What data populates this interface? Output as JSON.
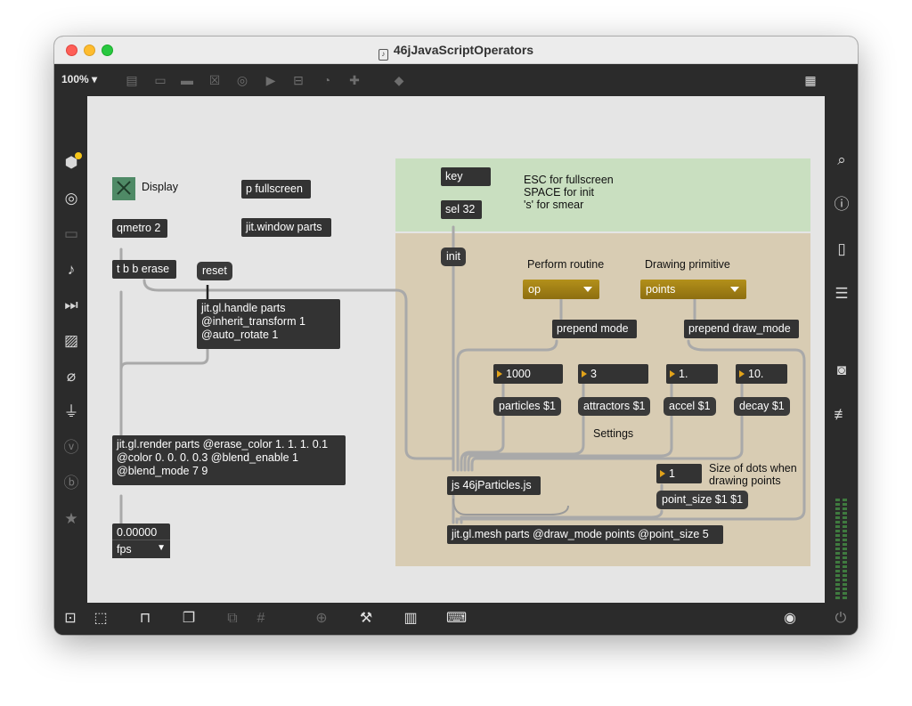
{
  "window": {
    "title": "46jJavaScriptOperators"
  },
  "toolbar": {
    "zoom": "100%"
  },
  "objects": {
    "qmetro": "qmetro 2",
    "tbb": "t b b erase",
    "reset": "reset",
    "handle": [
      "jit.gl.handle parts",
      "@inherit_transform 1",
      "@auto_rotate 1"
    ],
    "render": [
      "jit.gl.render parts @erase_color 1. 1. 1. 0.1",
      "@color 0. 0. 0. 0.3 @blend_enable 1",
      "@blend_mode 7 9"
    ],
    "fps_value": "0.00000",
    "fps_menu": "fps",
    "p_fullscreen": "p fullscreen",
    "jit_window": "jit.window parts",
    "key": "key",
    "sel": "sel 32",
    "init": "init",
    "mode_menu": "op",
    "draw_menu": "points",
    "prepend_mode": "prepend mode",
    "prepend_draw": "prepend draw_mode",
    "num_particles": "1000",
    "num_attractors": "3",
    "num_accel": "1.",
    "num_decay": "10.",
    "msg_particles": "particles $1",
    "msg_attractors": "attractors $1",
    "msg_accel": "accel $1",
    "msg_decay": "decay $1",
    "js": "js 46jParticles.js",
    "num_pointsize": "1",
    "msg_pointsize": "point_size $1 $1",
    "mesh": "jit.gl.mesh parts @draw_mode points @point_size 5"
  },
  "comments": {
    "display": "Display",
    "esc": [
      "ESC for fullscreen",
      "SPACE for init",
      "'s' for smear"
    ],
    "perform": "Perform routine",
    "drawing": "Drawing primitive",
    "settings": "Settings",
    "size": [
      "Size of dots when",
      "drawing points"
    ]
  },
  "colors": {
    "canvas": "#e5e5e5",
    "green_panel": "#c9dfc0",
    "tan_panel": "#d8ccb3",
    "toggle": "#4f8a66",
    "menu_gold": "#a88518",
    "number_triangle": "#e2a31a",
    "status_dot": "#f5c518"
  }
}
